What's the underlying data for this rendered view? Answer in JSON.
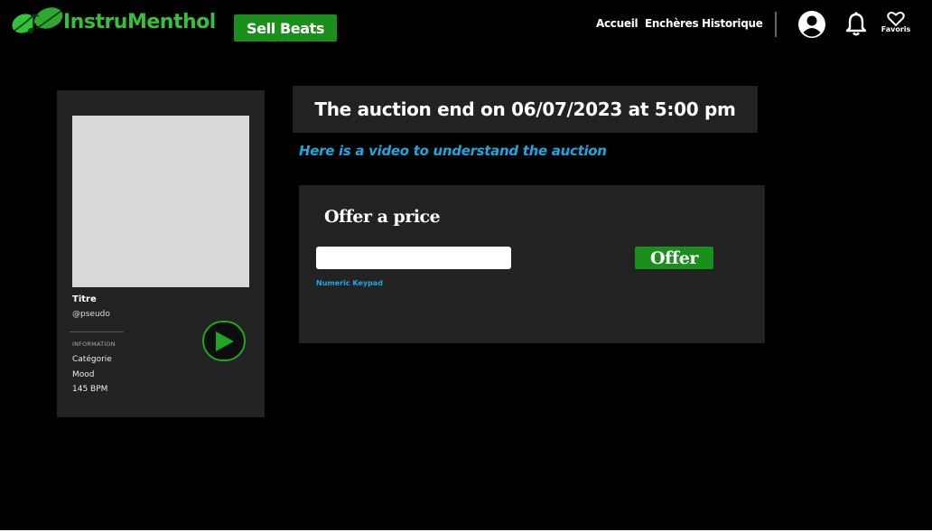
{
  "header": {
    "brand": "InstruMenthol",
    "sell_label": "Sell Beats",
    "nav": [
      "Accueil",
      "Enchères",
      "Historique"
    ],
    "favorites_label": "Favoris",
    "icons": {
      "logo": "leaf-logo-icon",
      "user": "user-circle-icon",
      "notifications": "bell-icon",
      "favorites": "heart-icon"
    }
  },
  "beat_card": {
    "title": "Titre",
    "pseudo": "@pseudo",
    "info_label": "INFORMATION",
    "category": "Catégorie",
    "mood": "Mood",
    "bpm": "145 BPM",
    "play_icon": "play-icon"
  },
  "auction": {
    "end_text": "The auction end on 06/07/2023 at 5:00 pm",
    "video_link": "Here is a video to understand the auction"
  },
  "offer": {
    "title": "Offer a price",
    "input_value": "",
    "keypad_label": "Numeric Keypad",
    "button_label": "Offer"
  },
  "colors": {
    "background": "#000000",
    "panel": "#222222",
    "brand_green": "#35c13a",
    "button_green": "#1b8f1b",
    "link_blue": "#1ba8e0"
  }
}
